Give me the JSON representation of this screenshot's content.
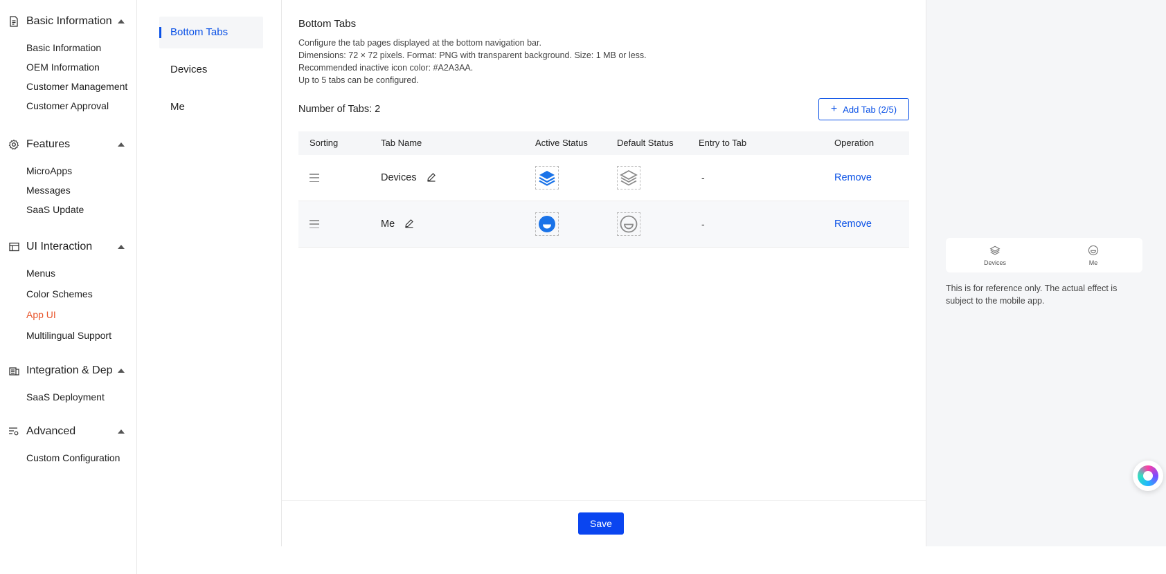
{
  "nav": {
    "groups": [
      {
        "label": "Basic Information",
        "icon": "document-icon",
        "items": [
          "Basic Information",
          "OEM Information",
          "Customer Management",
          "Customer Approval"
        ]
      },
      {
        "label": "Features",
        "icon": "gear-icon",
        "items": [
          "MicroApps",
          "Messages",
          "SaaS Update"
        ]
      },
      {
        "label": "UI Interaction",
        "icon": "window-icon",
        "items": [
          "Menus",
          "Color Schemes",
          "App UI",
          "Multilingual Support"
        ]
      },
      {
        "label": "Integration & Dep...",
        "icon": "integration-icon",
        "items": [
          "SaaS Deployment"
        ]
      },
      {
        "label": "Advanced",
        "icon": "settings-list-icon",
        "items": [
          "Custom Configuration"
        ]
      }
    ],
    "active_item": "App UI",
    "active_color": "#e8542a"
  },
  "sub_nav": {
    "items": [
      "Bottom Tabs",
      "Devices",
      "Me"
    ],
    "active": "Bottom Tabs"
  },
  "main": {
    "title": "Bottom Tabs",
    "description": [
      "Configure the tab pages displayed at the bottom navigation bar.",
      "Dimensions: 72 × 72 pixels. Format: PNG with transparent background. Size: 1 MB or less.",
      "Recommended inactive icon color: #A2A3AA.",
      "Up to 5 tabs can be configured."
    ],
    "tab_count_label": "Number of Tabs: 2",
    "add_tab_label": "Add Tab (2/5)",
    "table": {
      "headers": [
        "Sorting",
        "Tab Name",
        "Active Status",
        "Default Status",
        "Entry to Tab",
        "Operation"
      ],
      "rows": [
        {
          "name": "Devices",
          "active_icon": "layers-icon-active",
          "default_icon": "layers-icon-default",
          "entry": "-",
          "operation": "Remove"
        },
        {
          "name": "Me",
          "active_icon": "smile-icon-active",
          "default_icon": "smile-icon-default",
          "entry": "-",
          "operation": "Remove"
        }
      ]
    },
    "save_label": "Save"
  },
  "preview": {
    "tabs": [
      {
        "label": "Devices",
        "icon": "layers-icon"
      },
      {
        "label": "Me",
        "icon": "smile-icon"
      }
    ],
    "note": "This is for reference only. The actual effect is subject to the mobile app."
  },
  "colors": {
    "primary": "#0a51e6",
    "save_bg": "#0a45f0",
    "inactive_icon": "#A2A3AA",
    "active_icon": "#1a73e8"
  }
}
